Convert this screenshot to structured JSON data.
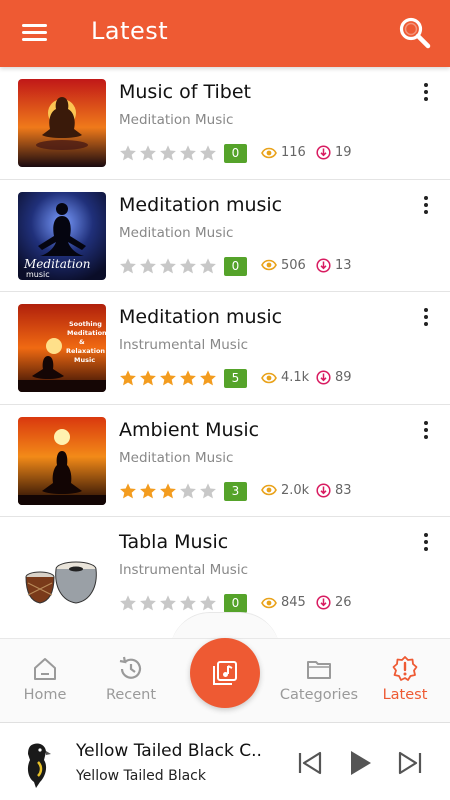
{
  "header": {
    "title": "Latest",
    "menu_icon": "menu-icon",
    "search_icon": "search-icon"
  },
  "colors": {
    "accent": "#ee5a33",
    "badge": "#55a32a",
    "star_on": "#f39c1f",
    "star_off": "#c8c8c8",
    "views": "#e9a21a",
    "download": "#d81b60"
  },
  "songs": [
    {
      "title": "Music of Tibet",
      "category": "Meditation Music",
      "rating": 0,
      "rating_badge": "0",
      "views": "116",
      "downloads": "19"
    },
    {
      "title": "Meditation music",
      "category": "Meditation Music",
      "rating": 0,
      "rating_badge": "0",
      "views": "506",
      "downloads": "13",
      "art_text": "Meditation",
      "art_text2": "music"
    },
    {
      "title": "Meditation music",
      "category": "Instrumental Music",
      "rating": 5,
      "rating_badge": "5",
      "views": "4.1k",
      "downloads": "89",
      "art_text": "Soothing",
      "art_text2": "Meditation",
      "art_text3": "&",
      "art_text4": "Relaxation",
      "art_text5": "Music"
    },
    {
      "title": "Ambient Music",
      "category": "Meditation Music",
      "rating": 3,
      "rating_badge": "3",
      "views": "2.0k",
      "downloads": "83"
    },
    {
      "title": "Tabla Music",
      "category": "Instrumental Music",
      "rating": 0,
      "rating_badge": "0",
      "views": "845",
      "downloads": "26"
    }
  ],
  "nav": {
    "home": "Home",
    "recent": "Recent",
    "categories": "Categories",
    "latest": "Latest"
  },
  "player": {
    "title": "Yellow Tailed Black C..",
    "subtitle": "Yellow Tailed Black"
  }
}
